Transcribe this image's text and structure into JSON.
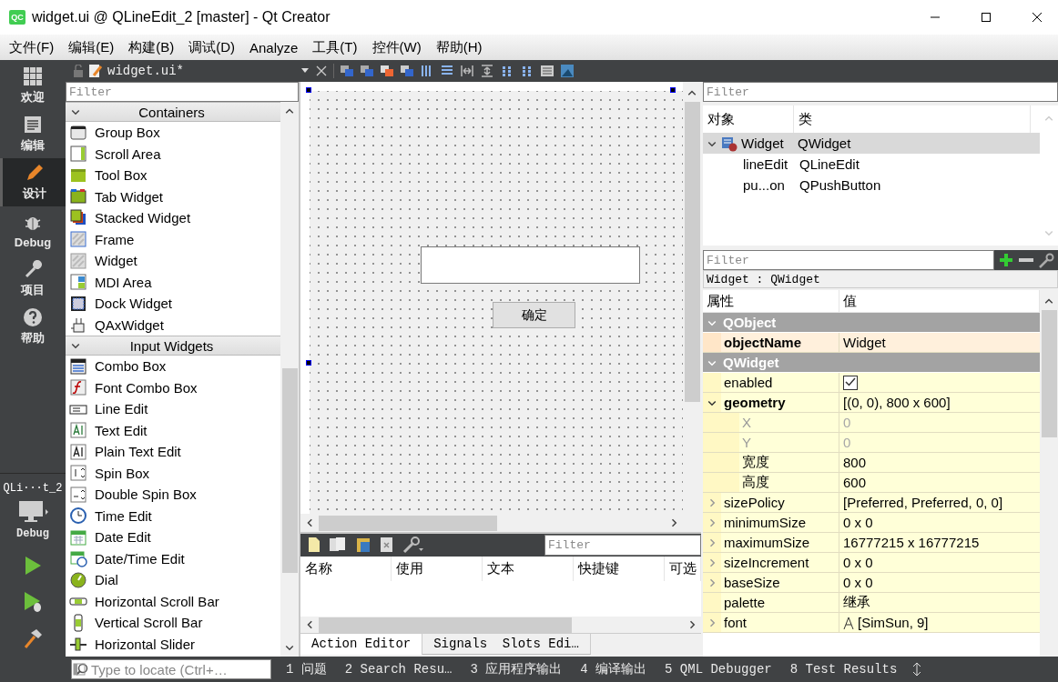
{
  "window": {
    "logo": "QC",
    "title": "widget.ui @ QLineEdit_2 [master] - Qt Creator"
  },
  "menu": [
    "文件(F)",
    "编辑(E)",
    "构建(B)",
    "调试(D)",
    "Analyze",
    "工具(T)",
    "控件(W)",
    "帮助(H)"
  ],
  "modes": [
    {
      "kind": "welcome",
      "label": "欢迎",
      "selected": false
    },
    {
      "kind": "edit",
      "label": "编辑",
      "selected": false
    },
    {
      "kind": "design",
      "label": "设计",
      "selected": true
    },
    {
      "kind": "debug",
      "label": "Debug",
      "selected": false
    },
    {
      "kind": "projects",
      "label": "项目",
      "selected": false
    },
    {
      "kind": "help",
      "label": "帮助",
      "selected": false
    }
  ],
  "target": {
    "project": "QLi···t_2",
    "config": "Debug"
  },
  "editor_tab": {
    "file": "widget.ui*"
  },
  "widget_box": {
    "filter_placeholder": "Filter",
    "categories": [
      {
        "title": "Containers",
        "expanded": true,
        "items": [
          "Group Box",
          "Scroll Area",
          "Tool Box",
          "Tab Widget",
          "Stacked Widget",
          "Frame",
          "Widget",
          "MDI Area",
          "Dock Widget",
          "QAxWidget"
        ]
      },
      {
        "title": "Input Widgets",
        "expanded": true,
        "items": [
          "Combo Box",
          "Font Combo Box",
          "Line Edit",
          "Text Edit",
          "Plain Text Edit",
          "Spin Box",
          "Double Spin Box",
          "Time Edit",
          "Date Edit",
          "Date/Time Edit",
          "Dial",
          "Horizontal Scroll Bar",
          "Vertical Scroll Bar",
          "Horizontal Slider"
        ]
      }
    ]
  },
  "form": {
    "button_text": "确定"
  },
  "action_editor": {
    "filter_placeholder": "Filter",
    "columns": [
      "名称",
      "使用",
      "文本",
      "快捷键",
      "可选"
    ],
    "tabs": [
      {
        "label": "Action Editor",
        "selected": true
      },
      {
        "label": "Signals  Slots Edi…",
        "selected": false
      }
    ]
  },
  "object_inspector": {
    "filter_placeholder": "Filter",
    "columns": [
      "对象",
      "类"
    ],
    "tree": [
      {
        "object": "Widget",
        "class": "QWidget",
        "selected": true,
        "expanded": true,
        "children": [
          {
            "object": "lineEdit",
            "class": "QLineEdit",
            "selected": false
          },
          {
            "object": "pu...on",
            "class": "QPushButton",
            "selected": false
          }
        ]
      }
    ]
  },
  "property_editor": {
    "filter_placeholder": "Filter",
    "class_label": "Widget : QWidget",
    "columns": [
      "属性",
      "值"
    ],
    "groups": [
      {
        "name": "QObject",
        "expanded": true,
        "properties": [
          {
            "name": "objectName",
            "kind": "text",
            "value": "Widget",
            "modified": true,
            "expandable": false,
            "expanded": false,
            "disabled": false
          }
        ]
      },
      {
        "name": "QWidget",
        "expanded": true,
        "properties": [
          {
            "name": "enabled",
            "kind": "checkbox",
            "checked": true,
            "modified": false,
            "expandable": false,
            "expanded": false,
            "disabled": false
          },
          {
            "name": "geometry",
            "kind": "text",
            "value": "[(0, 0), 800 x 600]",
            "modified": true,
            "expandable": true,
            "expanded": true,
            "disabled": false,
            "children": [
              {
                "name": "X",
                "kind": "text",
                "value": "0",
                "modified": false,
                "expandable": false,
                "expanded": false,
                "disabled": true
              },
              {
                "name": "Y",
                "kind": "text",
                "value": "0",
                "modified": false,
                "expandable": false,
                "expanded": false,
                "disabled": true
              },
              {
                "name": "宽度",
                "kind": "text",
                "value": "800",
                "modified": false,
                "expandable": false,
                "expanded": false,
                "disabled": false
              },
              {
                "name": "高度",
                "kind": "text",
                "value": "600",
                "modified": false,
                "expandable": false,
                "expanded": false,
                "disabled": false
              }
            ]
          },
          {
            "name": "sizePolicy",
            "kind": "text",
            "value": "[Preferred, Preferred, 0, 0]",
            "modified": false,
            "expandable": true,
            "expanded": false,
            "disabled": false
          },
          {
            "name": "minimumSize",
            "kind": "text",
            "value": "0 x 0",
            "modified": false,
            "expandable": true,
            "expanded": false,
            "disabled": false
          },
          {
            "name": "maximumSize",
            "kind": "text",
            "value": "16777215 x 16777215",
            "modified": false,
            "expandable": true,
            "expanded": false,
            "disabled": false
          },
          {
            "name": "sizeIncrement",
            "kind": "text",
            "value": "0 x 0",
            "modified": false,
            "expandable": true,
            "expanded": false,
            "disabled": false
          },
          {
            "name": "baseSize",
            "kind": "text",
            "value": "0 x 0",
            "modified": false,
            "expandable": true,
            "expanded": false,
            "disabled": false
          },
          {
            "name": "palette",
            "kind": "text",
            "value": "继承",
            "modified": false,
            "expandable": false,
            "expanded": false,
            "disabled": false
          },
          {
            "name": "font",
            "kind": "font",
            "value": "[SimSun, 9]",
            "modified": false,
            "expandable": true,
            "expanded": false,
            "disabled": false
          }
        ]
      }
    ]
  },
  "status_bar": {
    "locate_placeholder": "Type to locate (Ctrl+…",
    "panes": [
      "1 问题",
      "2 Search Resu…",
      "3 应用程序输出",
      "4 编译输出",
      "5 QML Debugger",
      "8 Test Results"
    ]
  }
}
